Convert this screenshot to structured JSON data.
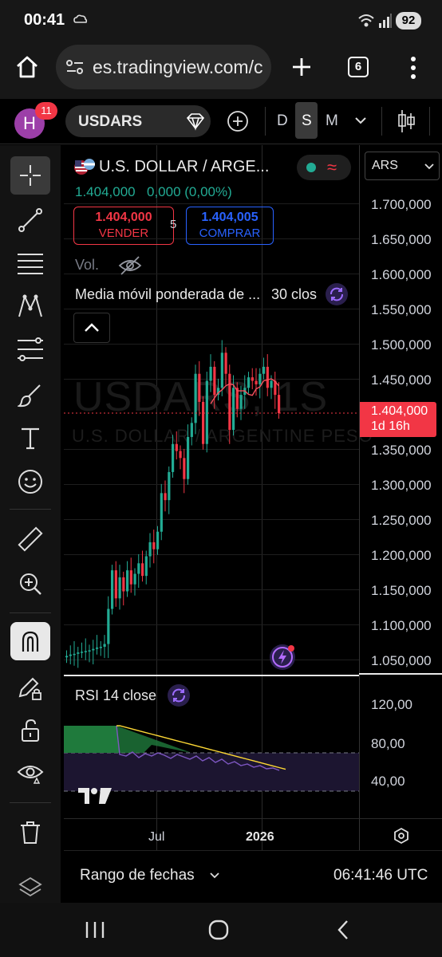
{
  "status_bar": {
    "time": "00:41",
    "battery": "92"
  },
  "browser": {
    "url": "es.tradingview.com/c",
    "tab_count": "6"
  },
  "toolbar": {
    "avatar_letter": "H",
    "notifications": "11",
    "symbol": "USDARS",
    "timeframes": [
      "D",
      "S",
      "M"
    ],
    "active_timeframe": "S"
  },
  "legend": {
    "title": "U.S. DOLLAR / ARGE...",
    "last": "1.404,000",
    "change": "0,000 (0,00%)",
    "sell_price": "1.404,000",
    "sell_label": "VENDER",
    "spread": "5",
    "buy_price": "1.404,005",
    "buy_label": "COMPRAR",
    "volume_label": "Vol.",
    "indicator": "Media móvil ponderada de ...",
    "indicator_param": "30 clos"
  },
  "currency": "ARS",
  "watermark": {
    "symbol": "USDARS, 1S",
    "name": "U.S. DOLLAR / ARGENTINE PESO"
  },
  "price_axis": {
    "labels": [
      "1.700,000",
      "1.650,000",
      "1.600,000",
      "1.550,000",
      "1.500,000",
      "1.450,000",
      "1.350,000",
      "1.300,000",
      "1.250,000",
      "1.200,000",
      "1.150,000",
      "1.100,000",
      "1.050,000"
    ],
    "current_price": "1.404,000",
    "countdown": "1d 16h"
  },
  "rsi": {
    "label": "RSI 14 close",
    "labels": [
      "120,00",
      "80,00",
      "40,00"
    ]
  },
  "x_axis": {
    "labels": [
      "Jul",
      "2026"
    ]
  },
  "bottom_bar": {
    "range_label": "Rango de fechas",
    "clock": "06:41:46 UTC"
  },
  "colors": {
    "up": "#22ab94",
    "down": "#f23645",
    "wma": "#f7525f",
    "rsi_line": "#7e57c2",
    "rsi_ma": "#fdd835",
    "accent": "#2962ff"
  }
}
